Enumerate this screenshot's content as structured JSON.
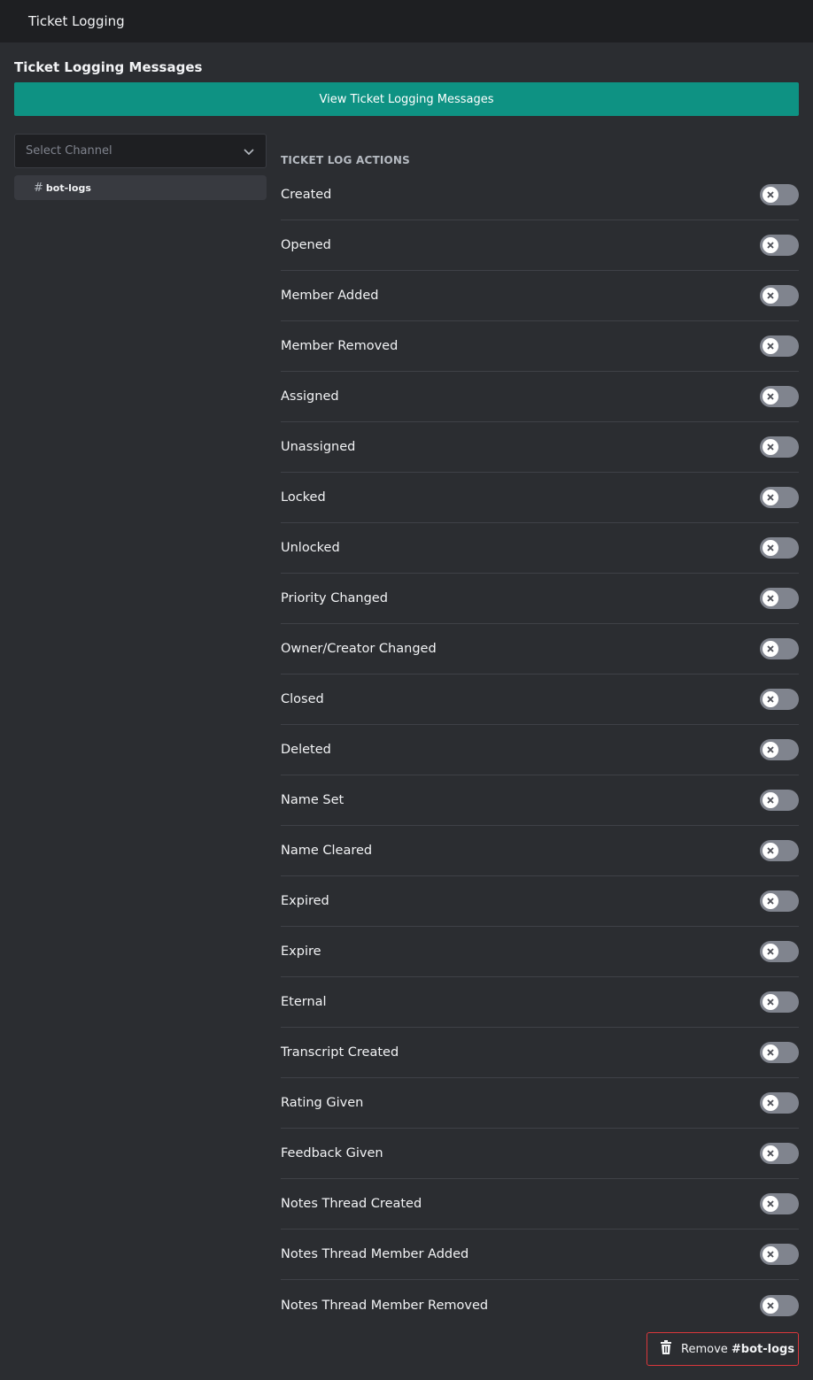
{
  "header": {
    "title": "Ticket Logging"
  },
  "section": {
    "title": "Ticket Logging Messages"
  },
  "view_button": {
    "label": "View Ticket Logging Messages",
    "color": "#0e9283"
  },
  "channel_select": {
    "placeholder": "Select Channel"
  },
  "selected_channel": {
    "hash": "#",
    "name": "bot-logs"
  },
  "actions": {
    "header": "TICKET LOG ACTIONS",
    "items": [
      {
        "label": "Created",
        "enabled": false
      },
      {
        "label": "Opened",
        "enabled": false
      },
      {
        "label": "Member Added",
        "enabled": false
      },
      {
        "label": "Member Removed",
        "enabled": false
      },
      {
        "label": "Assigned",
        "enabled": false
      },
      {
        "label": "Unassigned",
        "enabled": false
      },
      {
        "label": "Locked",
        "enabled": false
      },
      {
        "label": "Unlocked",
        "enabled": false
      },
      {
        "label": "Priority Changed",
        "enabled": false
      },
      {
        "label": "Owner/Creator Changed",
        "enabled": false
      },
      {
        "label": "Closed",
        "enabled": false
      },
      {
        "label": "Deleted",
        "enabled": false
      },
      {
        "label": "Name Set",
        "enabled": false
      },
      {
        "label": "Name Cleared",
        "enabled": false
      },
      {
        "label": "Expired",
        "enabled": false
      },
      {
        "label": "Expire",
        "enabled": false
      },
      {
        "label": "Eternal",
        "enabled": false
      },
      {
        "label": "Transcript Created",
        "enabled": false
      },
      {
        "label": "Rating Given",
        "enabled": false
      },
      {
        "label": "Feedback Given",
        "enabled": false
      },
      {
        "label": "Notes Thread Created",
        "enabled": false
      },
      {
        "label": "Notes Thread Member Added",
        "enabled": false
      },
      {
        "label": "Notes Thread Member Removed",
        "enabled": false
      }
    ]
  },
  "remove_button": {
    "prefix": "Remove ",
    "target": "#bot-logs",
    "icon": "trash-icon",
    "border_color": "#da373c"
  }
}
